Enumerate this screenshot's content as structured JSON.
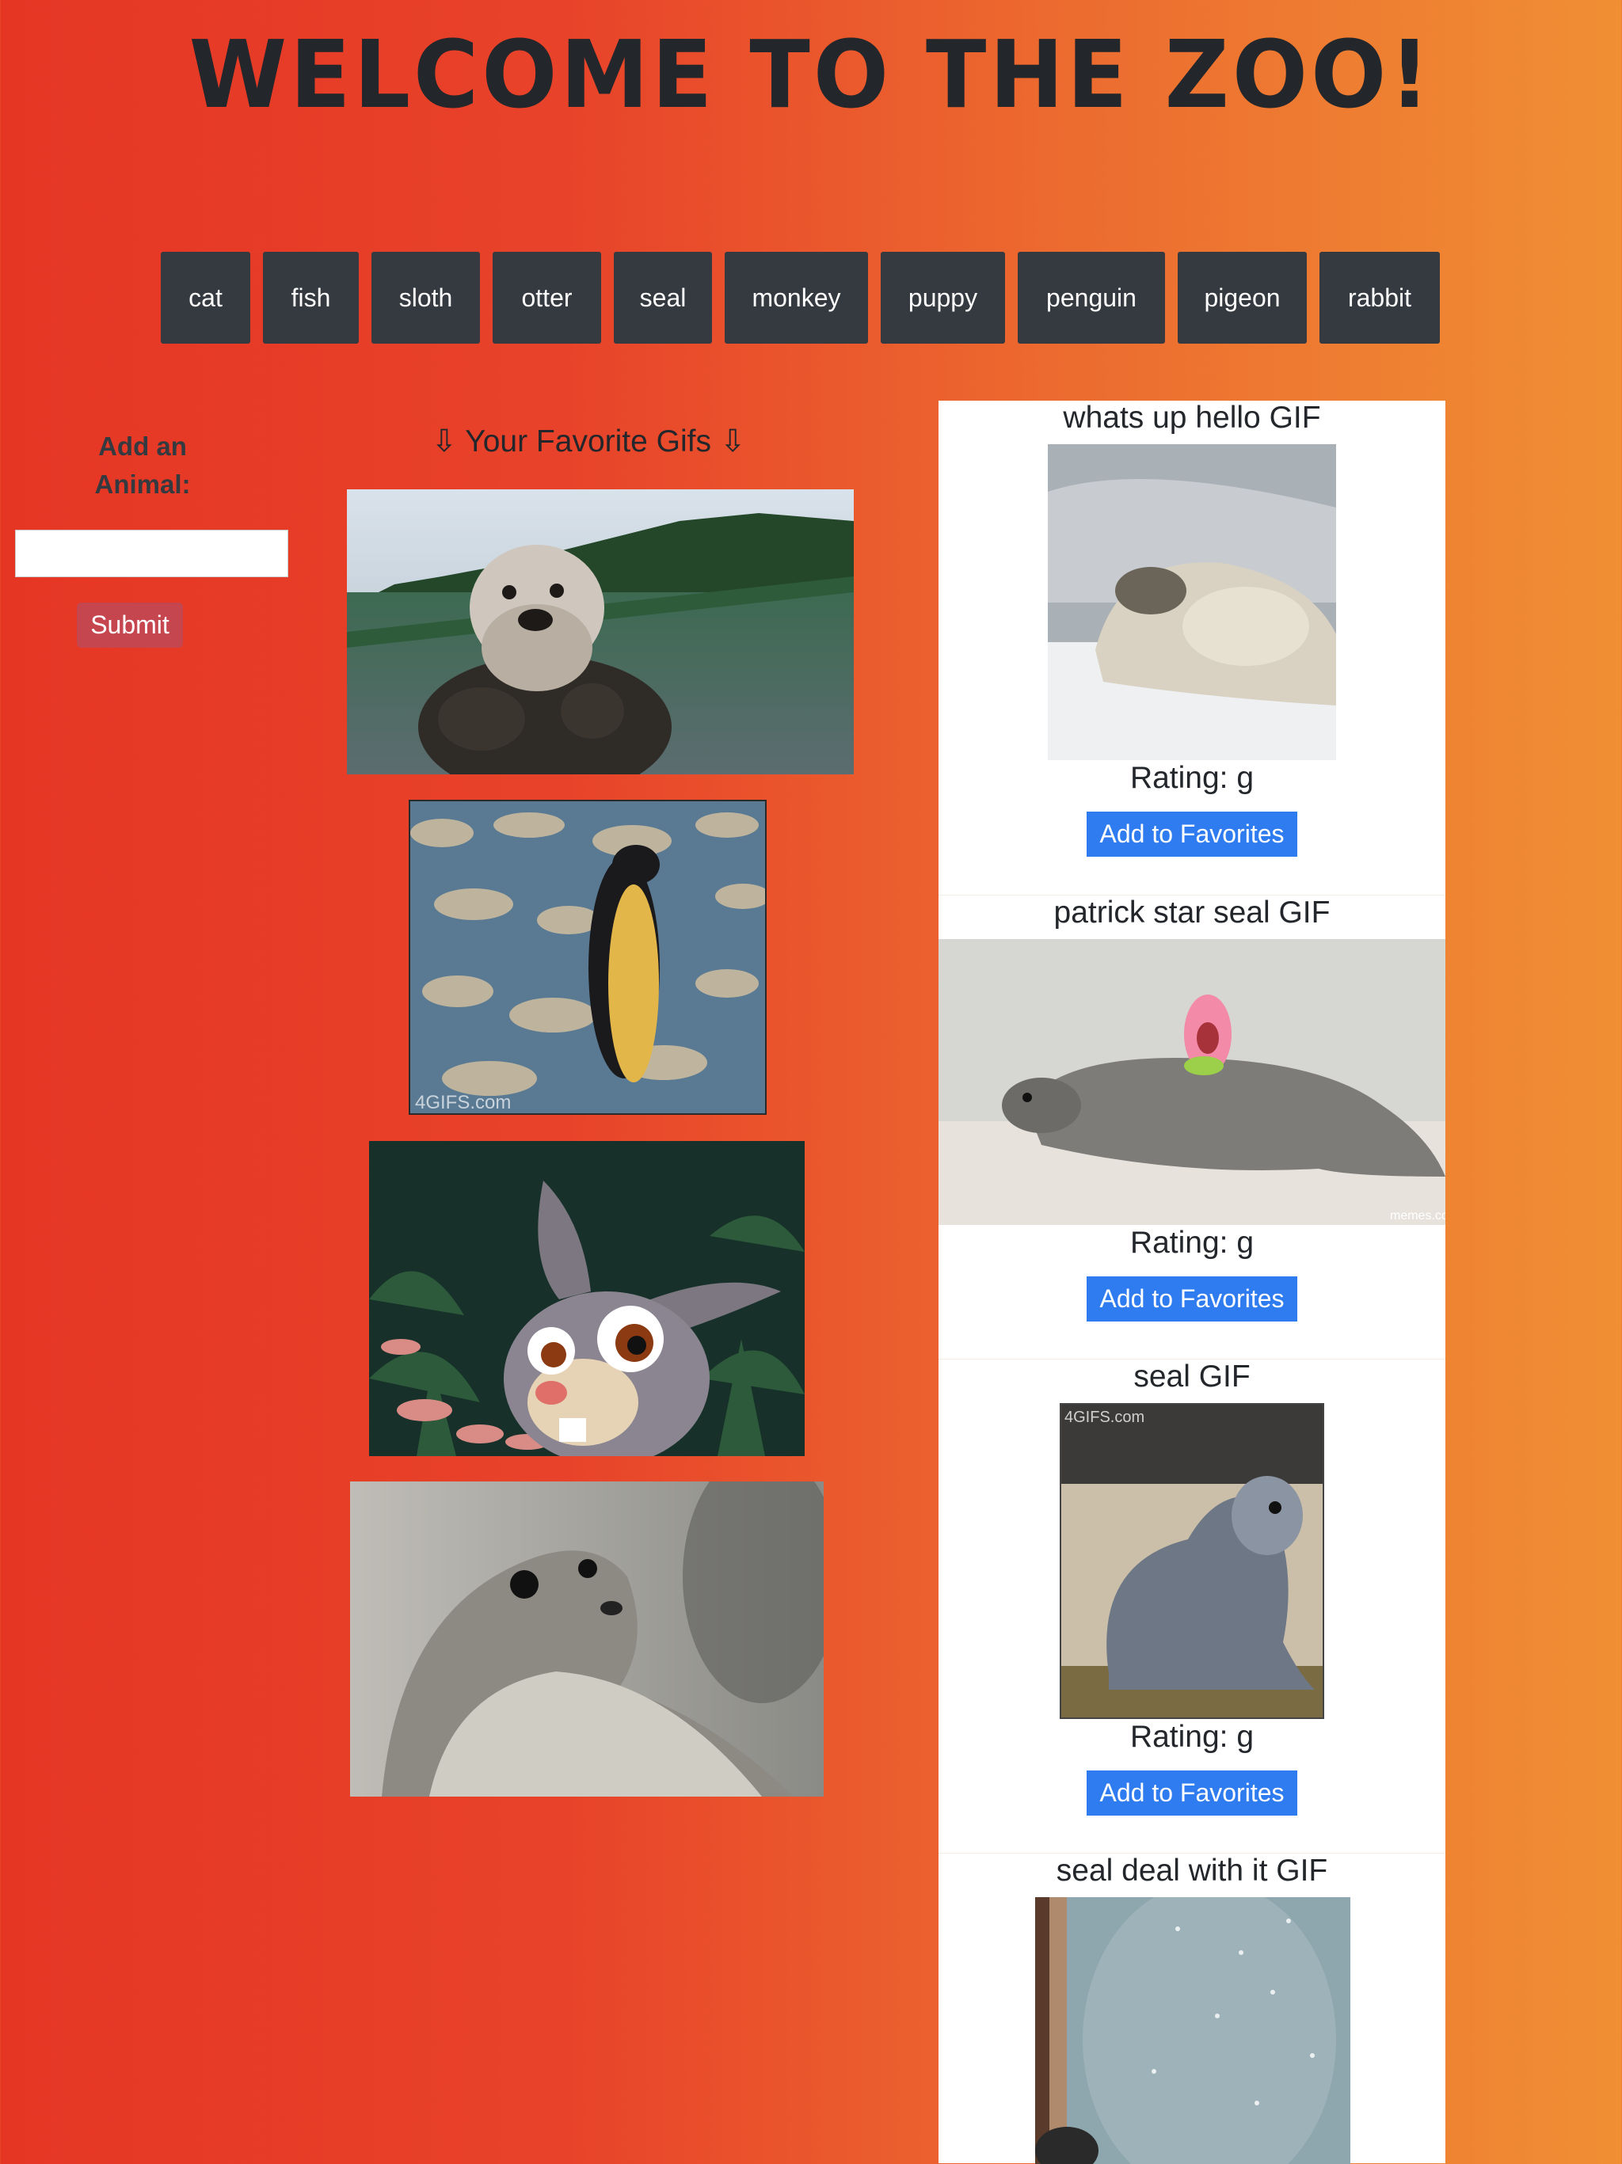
{
  "header": {
    "title": "Welcome to the Zoo!"
  },
  "animal_buttons": [
    "cat",
    "fish",
    "sloth",
    "otter",
    "seal",
    "monkey",
    "puppy",
    "penguin",
    "pigeon",
    "rabbit"
  ],
  "add_form": {
    "label": "Add an Animal:",
    "input_value": "",
    "submit_label": "Submit"
  },
  "favorites": {
    "heading": "⇩ Your Favorite Gifs ⇩",
    "items": [
      {
        "subject": "sea otter floating"
      },
      {
        "subject": "penguin",
        "watermark": "4GIFS.com"
      },
      {
        "subject": "cartoon rabbit"
      },
      {
        "subject": "seal looking back"
      }
    ]
  },
  "results": [
    {
      "title": "whats up hello GIF",
      "rating": "Rating: g",
      "button": "Add to Favorites"
    },
    {
      "title": "patrick star seal GIF",
      "rating": "Rating: g",
      "button": "Add to Favorites",
      "watermark": "memes.com"
    },
    {
      "title": "seal GIF",
      "rating": "Rating: g",
      "button": "Add to Favorites",
      "watermark": "4GIFS.com"
    },
    {
      "title": "seal deal with it GIF"
    }
  ],
  "colors": {
    "bg_left": "#e53624",
    "bg_right": "#f08f34",
    "dark_button": "#343a40",
    "submit": "#c6464f",
    "favorite_button": "#2f7bf0"
  }
}
